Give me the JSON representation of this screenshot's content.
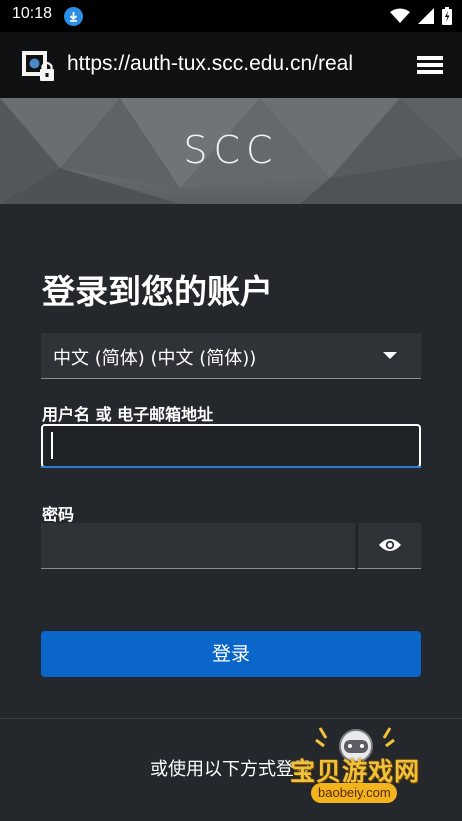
{
  "status_bar": {
    "time": "10:18",
    "icons": [
      "download-icon",
      "wifi-icon",
      "signal-icon",
      "battery-icon"
    ]
  },
  "browser": {
    "url": "https://auth-tux.scc.edu.cn/real",
    "icons": [
      "lock-icon",
      "menu-icon"
    ]
  },
  "banner": {
    "title": "SCC"
  },
  "login": {
    "heading": "登录到您的账户",
    "language_value": "中文 (简体) (中文 (简体))",
    "username_label": "用户名 或 电子邮箱地址",
    "username_value": "",
    "password_label": "密码",
    "password_value": "",
    "submit_label": "登录",
    "alt_login_text": "或使用以下方式登录"
  },
  "watermark": {
    "text": "宝贝游戏网",
    "url": "baobeiy.com"
  },
  "colors": {
    "background": "#24272b",
    "primary_button": "#0a66c8",
    "focus_accent": "#2d7dd2"
  }
}
